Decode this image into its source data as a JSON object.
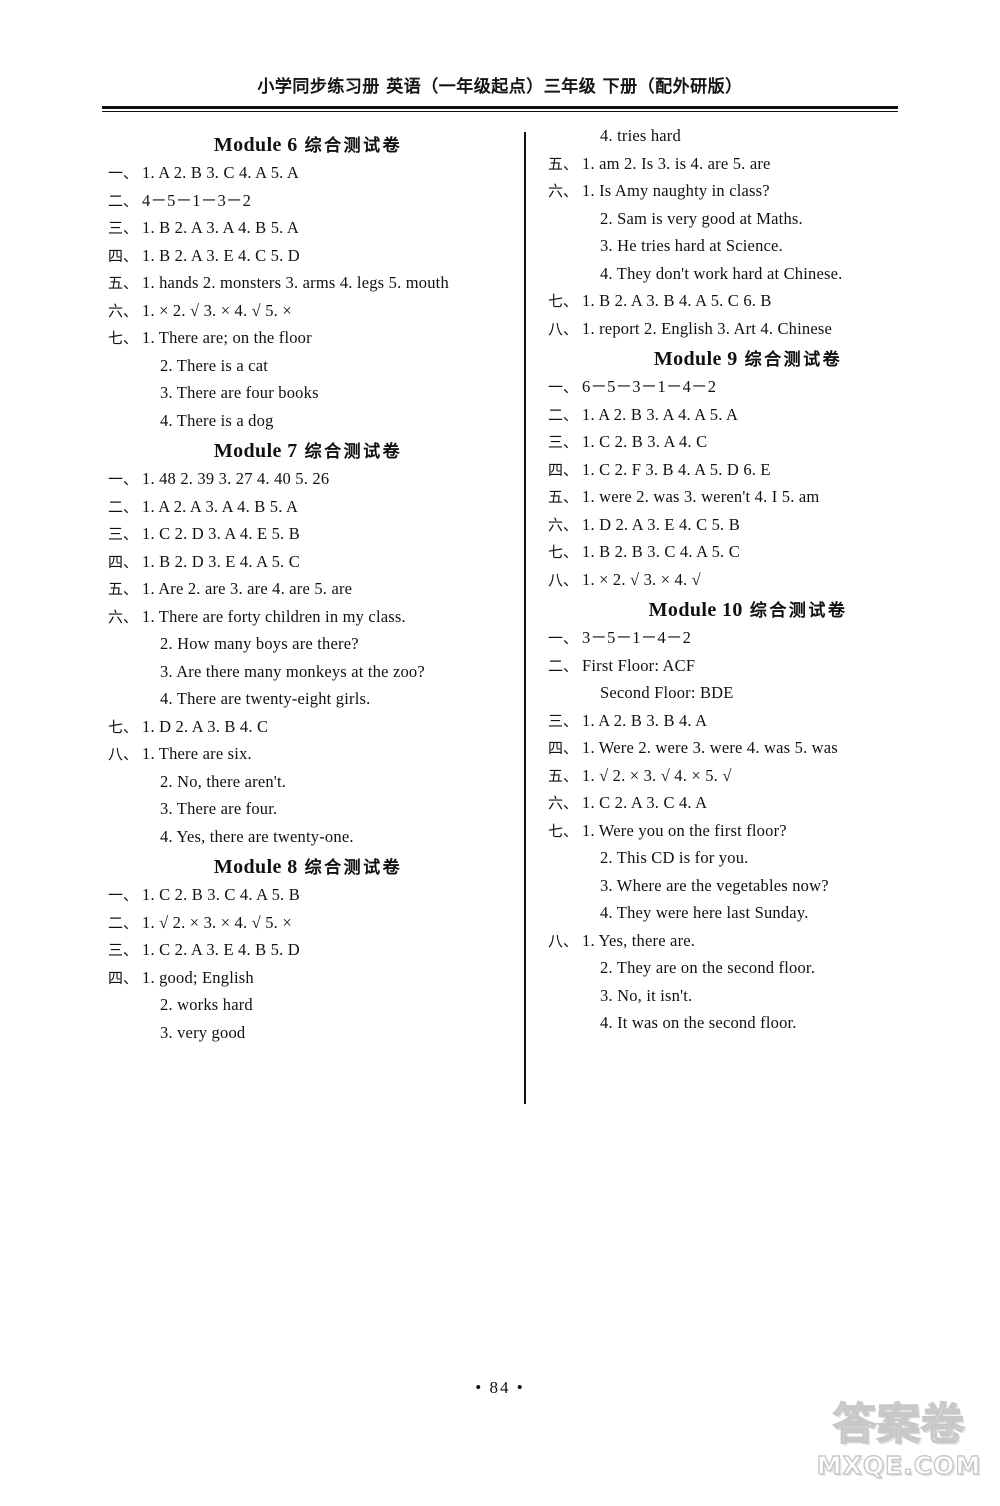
{
  "header": {
    "title": "小学同步练习册 英语（一年级起点）三年级 下册（配外研版）"
  },
  "footer": {
    "page_number": "• 84 •"
  },
  "watermark": {
    "chinese": "答案卷",
    "url": "MXQE.COM"
  },
  "left_column": {
    "sections": [
      {
        "title_en": "Module 6",
        "title_cn": "综合测试卷",
        "lines": [
          {
            "marker": "一、",
            "content": "1. A  2. B  3. C  4. A  5. A"
          },
          {
            "marker": "二、",
            "content": "4－5－1－3－2"
          },
          {
            "marker": "三、",
            "content": "1. B  2. A  3. A  4. B  5. A"
          },
          {
            "marker": "四、",
            "content": "1. B  2. A  3. E  4. C  5. D"
          },
          {
            "marker": "五、",
            "content": "1. hands  2. monsters  3. arms  4. legs  5. mouth"
          },
          {
            "marker": "六、",
            "content": "1. ×  2. √  3. ×  4. √  5. ×"
          },
          {
            "marker": "七、",
            "content": "1. There are; on the floor"
          },
          {
            "marker": "",
            "content": "2. There is a cat"
          },
          {
            "marker": "",
            "content": "3. There are four books"
          },
          {
            "marker": "",
            "content": "4. There is a dog"
          }
        ]
      },
      {
        "title_en": "Module 7",
        "title_cn": "综合测试卷",
        "lines": [
          {
            "marker": "一、",
            "content": "1. 48  2. 39  3. 27  4. 40  5. 26"
          },
          {
            "marker": "二、",
            "content": "1. A  2. A  3. A  4. B  5. A"
          },
          {
            "marker": "三、",
            "content": "1. C  2. D  3. A  4. E  5. B"
          },
          {
            "marker": "四、",
            "content": "1. B  2. D  3. E  4. A  5. C"
          },
          {
            "marker": "五、",
            "content": "1. Are  2. are  3. are  4. are  5. are"
          },
          {
            "marker": "六、",
            "content": "1. There are forty children in my class."
          },
          {
            "marker": "",
            "content": "2. How many boys are there?"
          },
          {
            "marker": "",
            "content": "3. Are there many monkeys at the zoo?"
          },
          {
            "marker": "",
            "content": "4. There are twenty-eight girls."
          },
          {
            "marker": "七、",
            "content": "1. D  2. A  3. B  4. C"
          },
          {
            "marker": "八、",
            "content": "1. There are six."
          },
          {
            "marker": "",
            "content": "2. No, there aren't."
          },
          {
            "marker": "",
            "content": "3. There are four."
          },
          {
            "marker": "",
            "content": "4. Yes, there are twenty-one."
          }
        ]
      },
      {
        "title_en": "Module 8",
        "title_cn": "综合测试卷",
        "lines": [
          {
            "marker": "一、",
            "content": "1. C  2. B  3. C  4. A  5. B"
          },
          {
            "marker": "二、",
            "content": "1. √  2. ×  3. ×  4. √  5. ×"
          },
          {
            "marker": "三、",
            "content": "1. C  2. A  3. E  4. B  5. D"
          },
          {
            "marker": "四、",
            "content": "1. good; English"
          },
          {
            "marker": "",
            "content": "2. works hard"
          },
          {
            "marker": "",
            "content": "3. very good"
          }
        ]
      }
    ]
  },
  "right_column": {
    "sections": [
      {
        "title_en": "",
        "title_cn": "",
        "lines": [
          {
            "marker": "",
            "content": "4. tries hard"
          },
          {
            "marker": "五、",
            "content": "1. am  2. Is  3. is  4. are  5. are"
          },
          {
            "marker": "六、",
            "content": "1. Is Amy naughty in class?"
          },
          {
            "marker": "",
            "content": "2. Sam is very good at Maths."
          },
          {
            "marker": "",
            "content": "3. He tries hard at Science."
          },
          {
            "marker": "",
            "content": "4. They don't work hard at Chinese."
          },
          {
            "marker": "七、",
            "content": "1. B  2. A  3. B  4. A  5. C  6. B"
          },
          {
            "marker": "八、",
            "content": "1. report  2. English  3. Art  4. Chinese"
          }
        ]
      },
      {
        "title_en": "Module 9",
        "title_cn": "综合测试卷",
        "lines": [
          {
            "marker": "一、",
            "content": "6－5－3－1－4－2"
          },
          {
            "marker": "二、",
            "content": "1. A  2. B  3. A  4. A  5. A"
          },
          {
            "marker": "三、",
            "content": "1. C  2. B  3. A  4. C"
          },
          {
            "marker": "四、",
            "content": "1. C  2. F  3. B  4. A  5. D  6. E"
          },
          {
            "marker": "五、",
            "content": "1. were  2. was  3. weren't  4. I  5. am"
          },
          {
            "marker": "六、",
            "content": "1. D  2. A  3. E  4. C  5. B"
          },
          {
            "marker": "七、",
            "content": "1. B  2. B  3. C  4. A  5. C"
          },
          {
            "marker": "八、",
            "content": "1. ×  2. √  3. ×  4. √"
          }
        ]
      },
      {
        "title_en": "Module 10",
        "title_cn": "综合测试卷",
        "lines": [
          {
            "marker": "一、",
            "content": "3－5－1－4－2"
          },
          {
            "marker": "二、",
            "content": "First Floor: ACF"
          },
          {
            "marker": "",
            "content": "Second Floor: BDE"
          },
          {
            "marker": "三、",
            "content": "1. A  2. B  3. B  4. A"
          },
          {
            "marker": "四、",
            "content": "1. Were  2. were  3. were  4. was  5. was"
          },
          {
            "marker": "五、",
            "content": "1. √  2. ×  3. √  4. ×  5. √"
          },
          {
            "marker": "六、",
            "content": "1. C  2. A  3. C  4. A"
          },
          {
            "marker": "七、",
            "content": "1. Were you on the first floor?"
          },
          {
            "marker": "",
            "content": "2. This CD is for you."
          },
          {
            "marker": "",
            "content": "3. Where are the vegetables now?"
          },
          {
            "marker": "",
            "content": "4. They were here last Sunday."
          },
          {
            "marker": "八、",
            "content": "1. Yes, there are."
          },
          {
            "marker": "",
            "content": "2. They are on the second floor."
          },
          {
            "marker": "",
            "content": "3. No, it isn't."
          },
          {
            "marker": "",
            "content": "4. It was on the second floor."
          }
        ]
      }
    ]
  }
}
